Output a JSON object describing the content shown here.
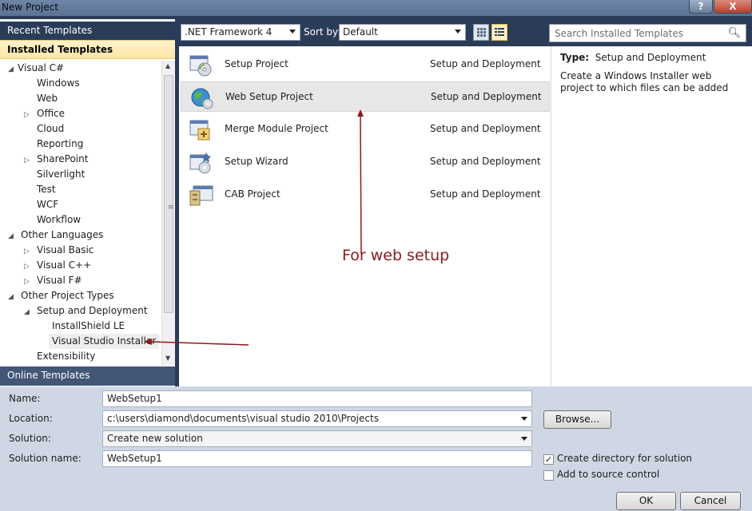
{
  "window": {
    "title": "New Project",
    "help_label": "?",
    "close_label": "X"
  },
  "sidebar": {
    "recent_label": "Recent Templates",
    "installed_label": "Installed Templates",
    "online_label": "Online Templates",
    "tree": [
      {
        "label": "Visual C#",
        "arrow": "◢"
      },
      {
        "label": "Windows"
      },
      {
        "label": "Web"
      },
      {
        "label": "Office",
        "arrow": "▷"
      },
      {
        "label": "Cloud"
      },
      {
        "label": "Reporting"
      },
      {
        "label": "SharePoint",
        "arrow": "▷"
      },
      {
        "label": "Silverlight"
      },
      {
        "label": "Test"
      },
      {
        "label": "WCF"
      },
      {
        "label": "Workflow"
      },
      {
        "label": "Other Languages",
        "arrow": "◢"
      },
      {
        "label": "Visual Basic",
        "arrow": "▷"
      },
      {
        "label": "Visual C++",
        "arrow": "▷"
      },
      {
        "label": "Visual F#",
        "arrow": "▷"
      },
      {
        "label": "Other Project Types",
        "arrow": "◢"
      },
      {
        "label": "Setup and Deployment",
        "arrow": "◢"
      },
      {
        "label": "InstallShield LE"
      },
      {
        "label": "Visual Studio Installer"
      },
      {
        "label": "Extensibility"
      }
    ]
  },
  "toolbar": {
    "framework": ".NET Framework 4",
    "sort_by_label": "Sort by:",
    "sort_by_value": "Default",
    "search_placeholder": "Search Installed Templates"
  },
  "templates": [
    {
      "name": "Setup Project",
      "category": "Setup and Deployment"
    },
    {
      "name": "Web Setup Project",
      "category": "Setup and Deployment"
    },
    {
      "name": "Merge Module Project",
      "category": "Setup and Deployment"
    },
    {
      "name": "Setup Wizard",
      "category": "Setup and Deployment"
    },
    {
      "name": "CAB Project",
      "category": "Setup and Deployment"
    }
  ],
  "description": {
    "type_label": "Type:",
    "type_value": "Setup and Deployment",
    "text": "Create a Windows Installer web project to which files can be added"
  },
  "annotation": {
    "text": "For web setup",
    "color": "#8b1a1a"
  },
  "form": {
    "name_label": "Name:",
    "name_value": "WebSetup1",
    "location_label": "Location:",
    "location_value": "c:\\users\\diamond\\documents\\visual studio 2010\\Projects",
    "solution_label": "Solution:",
    "solution_value": "Create new solution",
    "solution_name_label": "Solution name:",
    "solution_name_value": "WebSetup1",
    "browse_label": "Browse...",
    "create_dir_label": "Create directory for solution",
    "add_source_label": "Add to source control",
    "ok_label": "OK",
    "cancel_label": "Cancel"
  },
  "colors": {
    "frame": "#2b3c59",
    "selected_header": "#fde7a6",
    "annotation": "#8b1a1a"
  }
}
